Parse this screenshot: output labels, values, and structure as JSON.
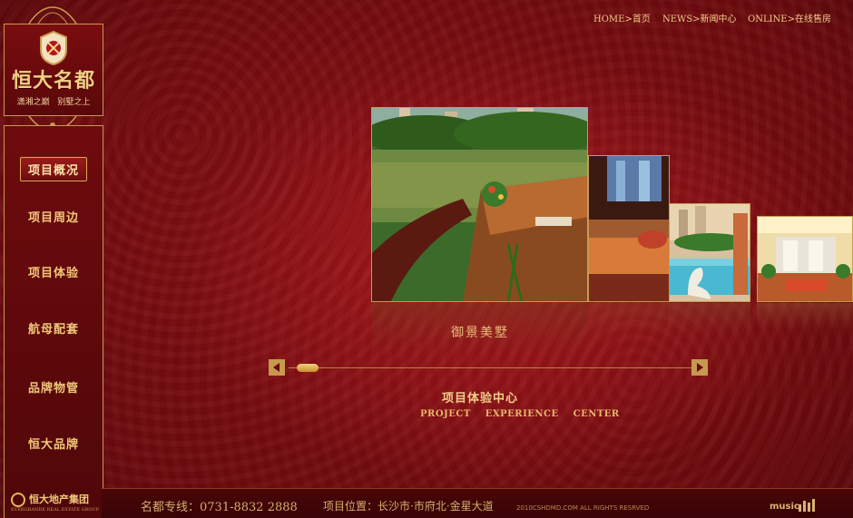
{
  "brand": {
    "title": "恒大名都",
    "subtitle": "潇湘之巅 别墅之上"
  },
  "top_nav": [
    {
      "label": "HOME>首页"
    },
    {
      "label": "NEWS>新闻中心"
    },
    {
      "label": "ONLINE>在线售房"
    }
  ],
  "side_nav": [
    {
      "label": "项目概况",
      "active": true
    },
    {
      "label": "项目周边",
      "active": false
    },
    {
      "label": "项目体验",
      "active": false
    },
    {
      "label": "航母配套",
      "active": false
    },
    {
      "label": "品牌物管",
      "active": false
    },
    {
      "label": "恒大品牌",
      "active": false
    }
  ],
  "gallery": {
    "main_caption": "御景美墅",
    "slider_position": 0.05
  },
  "section": {
    "title": "项目体验中心",
    "subtitle": "PROJECT EXPERIENCE CENTER"
  },
  "footer": {
    "group_name": "恒大地产集团",
    "group_small": "EVERGRANDE REAL ESTATE GROUP",
    "hotline": "名都专线：0731-8832 2888",
    "address": "项目位置：长沙市·市府北·金星大道",
    "copyright": "2010CSHDMD.COM ALL RIGHTS RESRVED",
    "music_label": "music"
  },
  "colors": {
    "accent_gold": "#f2cd8a",
    "background_red": "#7a0d10"
  }
}
